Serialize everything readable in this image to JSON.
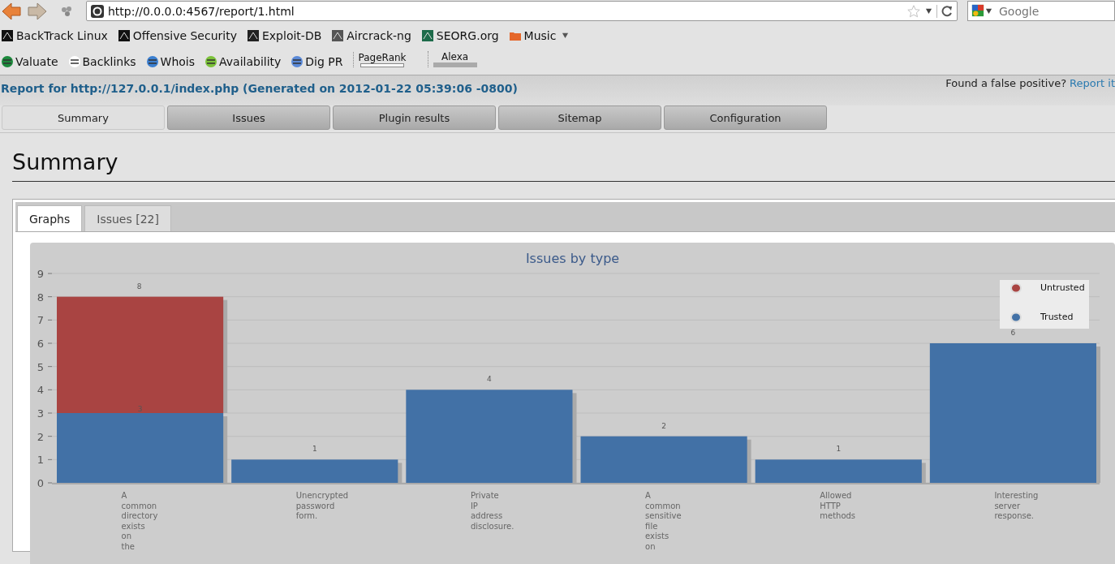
{
  "browser": {
    "url": "http://0.0.0.0:4567/report/1.html",
    "search_placeholder": "Google",
    "bookmarks": [
      {
        "label": "BackTrack Linux",
        "kind": "link"
      },
      {
        "label": "Offensive Security",
        "kind": "link"
      },
      {
        "label": "Exploit-DB",
        "kind": "link"
      },
      {
        "label": "Aircrack-ng",
        "kind": "link"
      },
      {
        "label": "SEORG.org",
        "kind": "link"
      },
      {
        "label": "Music",
        "kind": "folder"
      }
    ],
    "addon_tools": [
      {
        "label": "Valuate",
        "kind": "tool"
      },
      {
        "label": "Backlinks",
        "kind": "tool"
      },
      {
        "label": "Whois",
        "kind": "tool"
      },
      {
        "label": "Availability",
        "kind": "tool"
      },
      {
        "label": "Dig PR",
        "kind": "tool"
      },
      {
        "label": "PageRank",
        "kind": "meter"
      },
      {
        "label": "Alexa",
        "kind": "meter"
      }
    ]
  },
  "report": {
    "title": "Report for http://127.0.0.1/index.php (Generated on 2012-01-22 05:39:06 -0800)",
    "false_positive_text": "Found a false positive?",
    "report_link": "Report it",
    "tabs": [
      {
        "label": "Summary",
        "selected": true
      },
      {
        "label": "Issues",
        "selected": false
      },
      {
        "label": "Plugin results",
        "selected": false
      },
      {
        "label": "Sitemap",
        "selected": false
      },
      {
        "label": "Configuration",
        "selected": false
      }
    ],
    "heading": "Summary",
    "subtabs": [
      {
        "label": "Graphs",
        "selected": true
      },
      {
        "label": "Issues [22]",
        "selected": false
      }
    ],
    "chart_data": {
      "type": "bar",
      "title": "Issues by type",
      "stacked": true,
      "grid": true,
      "legend": "top-right",
      "categories": [
        "A common directory exists on the",
        "Unencrypted password form.",
        "Private IP address disclosure.",
        "A common sensitive file exists on",
        "Allowed HTTP methods",
        "Interesting server response."
      ],
      "series": [
        {
          "name": "Trusted",
          "color": "#4271a6",
          "values": [
            3,
            1,
            4,
            2,
            1,
            6
          ],
          "value_labels": [
            "3",
            "1",
            "4",
            "2",
            "1",
            "6"
          ]
        },
        {
          "name": "Untrusted",
          "color": "#a94442",
          "values": [
            5,
            null,
            null,
            null,
            null,
            null
          ],
          "value_labels": [
            null,
            null,
            null,
            null,
            null,
            null
          ]
        }
      ],
      "annotations": [
        {
          "x": "A common directory exists on the",
          "y": 8,
          "text": "8"
        }
      ],
      "ylim": [
        0,
        9
      ],
      "yticks": [
        0,
        1,
        2,
        3,
        4,
        5,
        6,
        7,
        8,
        9
      ]
    }
  }
}
